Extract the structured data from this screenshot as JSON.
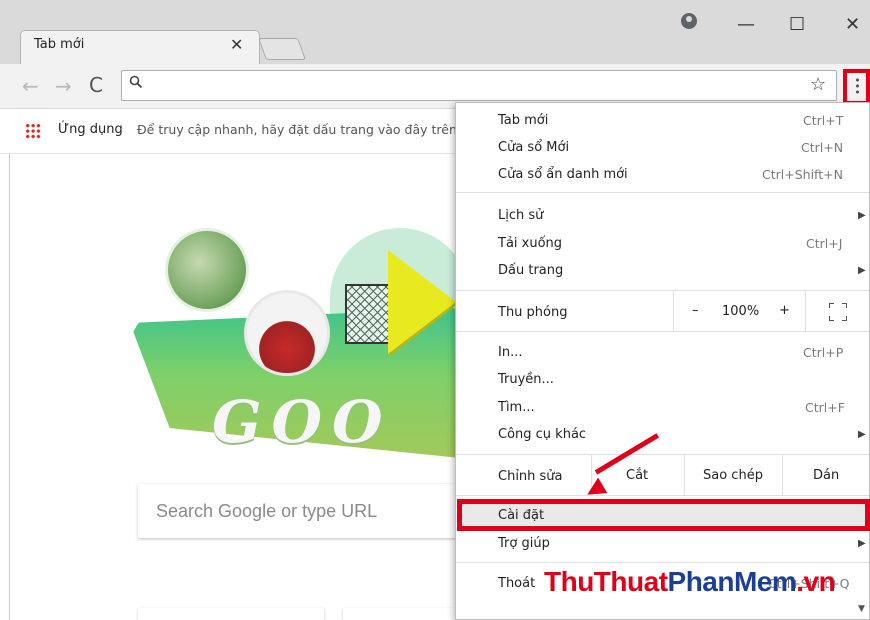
{
  "window": {
    "tab_title": "Tab mới",
    "tab_close": "✕",
    "minimize": "—",
    "maximize": "☐",
    "close": "✕"
  },
  "toolbar": {
    "back_icon": "←",
    "forward_icon": "→",
    "reload_icon": "C",
    "search_icon": "🔍",
    "star_icon": "☆",
    "menu_icon": "three-dots-vertical"
  },
  "bookmarks": {
    "apps_label": "Ứng dụng",
    "hint": "Để truy cập nhanh, hãy đặt dấu trang vào đây trên"
  },
  "page": {
    "doodle_text": "GOO",
    "search_placeholder": "Search Google or type URL"
  },
  "menu": {
    "new_tab": {
      "label": "Tab mới",
      "shortcut": "Ctrl+T"
    },
    "new_window": {
      "label": "Cửa sổ Mới",
      "shortcut": "Ctrl+N"
    },
    "incognito": {
      "label": "Cửa sổ ẩn danh mới",
      "shortcut": "Ctrl+Shift+N"
    },
    "history": {
      "label": "Lịch sử"
    },
    "downloads": {
      "label": "Tải xuống",
      "shortcut": "Ctrl+J"
    },
    "bookmarks": {
      "label": "Dấu trang"
    },
    "zoom": {
      "label": "Thu phóng",
      "minus": "–",
      "value": "100%",
      "plus": "+"
    },
    "print": {
      "label": "In...",
      "shortcut": "Ctrl+P"
    },
    "cast": {
      "label": "Truyền..."
    },
    "find": {
      "label": "Tìm...",
      "shortcut": "Ctrl+F"
    },
    "more_tools": {
      "label": "Công cụ khác"
    },
    "edit": {
      "label": "Chỉnh sửa",
      "cut": "Cắt",
      "copy": "Sao chép",
      "paste": "Dán"
    },
    "settings": {
      "label": "Cài đặt"
    },
    "help": {
      "label": "Trợ giúp"
    },
    "exit": {
      "label": "Thoát",
      "shortcut": "Ctrl+Shift+Q"
    },
    "submenu_arrow": "▶"
  },
  "watermark": {
    "part1": "ThuThuat",
    "part2": "PhanMem",
    "part3": ".vn"
  },
  "colors": {
    "highlight_red": "#e0001a",
    "watermark_blue": "#1b3f95"
  }
}
